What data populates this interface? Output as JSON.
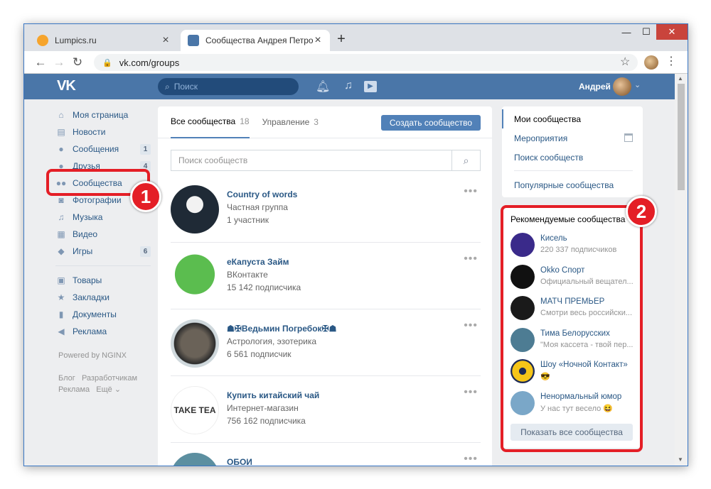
{
  "browser": {
    "tabs": [
      {
        "title": "Lumpics.ru",
        "active": false,
        "favicon_color": "#f6a42c"
      },
      {
        "title": "Сообщества Андрея Петрова",
        "active": true,
        "favicon_color": "#4a76a8"
      }
    ],
    "url": "vk.com/groups"
  },
  "header": {
    "logo": "VK",
    "search_placeholder": "Поиск",
    "user_name": "Андрей"
  },
  "sidebar": {
    "items": [
      {
        "label": "Моя страница",
        "icon": "home-icon",
        "count": ""
      },
      {
        "label": "Новости",
        "icon": "news-icon",
        "count": ""
      },
      {
        "label": "Сообщения",
        "icon": "messages-icon",
        "count": "1"
      },
      {
        "label": "Друзья",
        "icon": "friends-icon",
        "count": "4"
      },
      {
        "label": "Сообщества",
        "icon": "communities-icon",
        "count": ""
      },
      {
        "label": "Фотографии",
        "icon": "photos-icon",
        "count": ""
      },
      {
        "label": "Музыка",
        "icon": "music-icon",
        "count": ""
      },
      {
        "label": "Видео",
        "icon": "video-icon",
        "count": ""
      },
      {
        "label": "Игры",
        "icon": "games-icon",
        "count": "6"
      }
    ],
    "items2": [
      {
        "label": "Товары",
        "icon": "goods-icon"
      },
      {
        "label": "Закладки",
        "icon": "bookmarks-icon"
      },
      {
        "label": "Документы",
        "icon": "documents-icon"
      },
      {
        "label": "Реклама",
        "icon": "ads-icon"
      }
    ],
    "powered": "Powered by NGINX",
    "footer": [
      "Блог",
      "Разработчикам",
      "Реклама",
      "Ещё ⌄"
    ]
  },
  "main": {
    "tabs": [
      {
        "label": "Все сообщества",
        "count": "18"
      },
      {
        "label": "Управление",
        "count": "3"
      }
    ],
    "create_button": "Создать сообщество",
    "search_placeholder": "Поиск сообществ",
    "groups": [
      {
        "name": "Country of words",
        "type": "Частная группа",
        "members": "1 участник",
        "color": "#2e3a4c"
      },
      {
        "name": "еКапуста Займ",
        "type": "ВКонтакте",
        "members": "15 142 подписчика",
        "color": "#4cb84a"
      },
      {
        "name": "☗✠Ведьмин Погребок✠☗",
        "type": "Астрология, эзотерика",
        "members": "6 561 подписчик",
        "color": "#3a3a3a"
      },
      {
        "name": "Купить китайский чай",
        "type": "Интернет-магазин",
        "members": "756 162 подписчика",
        "color": "#ffffff"
      },
      {
        "name": "ОБОИ",
        "type": "",
        "members": "",
        "color": "#5c8fa0"
      }
    ]
  },
  "right": {
    "menu": [
      "Мои сообщества",
      "Мероприятия",
      "Поиск сообществ",
      "Популярные сообщества"
    ],
    "rec_title": "Рекомендуемые сообщества",
    "rec": [
      {
        "name": "Кисель",
        "sub": "220 337 подписчиков",
        "color": "#3a2a8a"
      },
      {
        "name": "Okko Спорт",
        "sub": "Официальный вещател...",
        "color": "#111111"
      },
      {
        "name": "МАТЧ ПРЕМЬЕР",
        "sub": "Смотри весь российски...",
        "color": "#1a1a1a"
      },
      {
        "name": "Тима Белорусских",
        "sub": "\"Моя кассета - твой пер...",
        "color": "#4d7c93"
      },
      {
        "name": "Шоу «Ночной Контакт»",
        "sub": "😎",
        "color": "#1c2a55"
      },
      {
        "name": "Ненормальный юмор",
        "sub": "У нас тут весело 😆",
        "color": "#7aa7c8"
      }
    ],
    "show_all": "Показать все сообщества"
  },
  "annotations": {
    "badge1": "1",
    "badge2": "2"
  }
}
